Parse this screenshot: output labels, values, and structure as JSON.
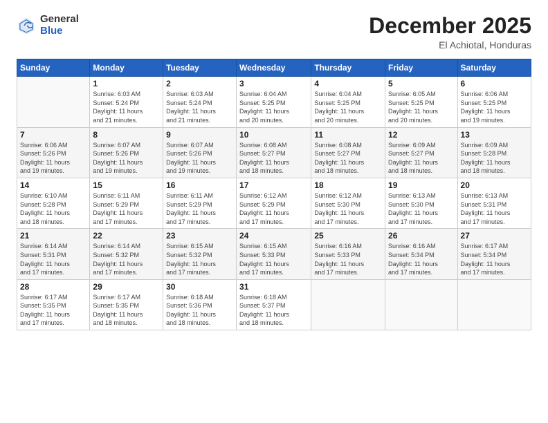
{
  "header": {
    "logo_general": "General",
    "logo_blue": "Blue",
    "month_title": "December 2025",
    "location": "El Achiotal, Honduras"
  },
  "days_of_week": [
    "Sunday",
    "Monday",
    "Tuesday",
    "Wednesday",
    "Thursday",
    "Friday",
    "Saturday"
  ],
  "weeks": [
    {
      "alt": false,
      "days": [
        {
          "num": "",
          "info": ""
        },
        {
          "num": "1",
          "info": "Sunrise: 6:03 AM\nSunset: 5:24 PM\nDaylight: 11 hours\nand 21 minutes."
        },
        {
          "num": "2",
          "info": "Sunrise: 6:03 AM\nSunset: 5:24 PM\nDaylight: 11 hours\nand 21 minutes."
        },
        {
          "num": "3",
          "info": "Sunrise: 6:04 AM\nSunset: 5:25 PM\nDaylight: 11 hours\nand 20 minutes."
        },
        {
          "num": "4",
          "info": "Sunrise: 6:04 AM\nSunset: 5:25 PM\nDaylight: 11 hours\nand 20 minutes."
        },
        {
          "num": "5",
          "info": "Sunrise: 6:05 AM\nSunset: 5:25 PM\nDaylight: 11 hours\nand 20 minutes."
        },
        {
          "num": "6",
          "info": "Sunrise: 6:06 AM\nSunset: 5:25 PM\nDaylight: 11 hours\nand 19 minutes."
        }
      ]
    },
    {
      "alt": true,
      "days": [
        {
          "num": "7",
          "info": "Sunrise: 6:06 AM\nSunset: 5:26 PM\nDaylight: 11 hours\nand 19 minutes."
        },
        {
          "num": "8",
          "info": "Sunrise: 6:07 AM\nSunset: 5:26 PM\nDaylight: 11 hours\nand 19 minutes."
        },
        {
          "num": "9",
          "info": "Sunrise: 6:07 AM\nSunset: 5:26 PM\nDaylight: 11 hours\nand 19 minutes."
        },
        {
          "num": "10",
          "info": "Sunrise: 6:08 AM\nSunset: 5:27 PM\nDaylight: 11 hours\nand 18 minutes."
        },
        {
          "num": "11",
          "info": "Sunrise: 6:08 AM\nSunset: 5:27 PM\nDaylight: 11 hours\nand 18 minutes."
        },
        {
          "num": "12",
          "info": "Sunrise: 6:09 AM\nSunset: 5:27 PM\nDaylight: 11 hours\nand 18 minutes."
        },
        {
          "num": "13",
          "info": "Sunrise: 6:09 AM\nSunset: 5:28 PM\nDaylight: 11 hours\nand 18 minutes."
        }
      ]
    },
    {
      "alt": false,
      "days": [
        {
          "num": "14",
          "info": "Sunrise: 6:10 AM\nSunset: 5:28 PM\nDaylight: 11 hours\nand 18 minutes."
        },
        {
          "num": "15",
          "info": "Sunrise: 6:11 AM\nSunset: 5:29 PM\nDaylight: 11 hours\nand 17 minutes."
        },
        {
          "num": "16",
          "info": "Sunrise: 6:11 AM\nSunset: 5:29 PM\nDaylight: 11 hours\nand 17 minutes."
        },
        {
          "num": "17",
          "info": "Sunrise: 6:12 AM\nSunset: 5:29 PM\nDaylight: 11 hours\nand 17 minutes."
        },
        {
          "num": "18",
          "info": "Sunrise: 6:12 AM\nSunset: 5:30 PM\nDaylight: 11 hours\nand 17 minutes."
        },
        {
          "num": "19",
          "info": "Sunrise: 6:13 AM\nSunset: 5:30 PM\nDaylight: 11 hours\nand 17 minutes."
        },
        {
          "num": "20",
          "info": "Sunrise: 6:13 AM\nSunset: 5:31 PM\nDaylight: 11 hours\nand 17 minutes."
        }
      ]
    },
    {
      "alt": true,
      "days": [
        {
          "num": "21",
          "info": "Sunrise: 6:14 AM\nSunset: 5:31 PM\nDaylight: 11 hours\nand 17 minutes."
        },
        {
          "num": "22",
          "info": "Sunrise: 6:14 AM\nSunset: 5:32 PM\nDaylight: 11 hours\nand 17 minutes."
        },
        {
          "num": "23",
          "info": "Sunrise: 6:15 AM\nSunset: 5:32 PM\nDaylight: 11 hours\nand 17 minutes."
        },
        {
          "num": "24",
          "info": "Sunrise: 6:15 AM\nSunset: 5:33 PM\nDaylight: 11 hours\nand 17 minutes."
        },
        {
          "num": "25",
          "info": "Sunrise: 6:16 AM\nSunset: 5:33 PM\nDaylight: 11 hours\nand 17 minutes."
        },
        {
          "num": "26",
          "info": "Sunrise: 6:16 AM\nSunset: 5:34 PM\nDaylight: 11 hours\nand 17 minutes."
        },
        {
          "num": "27",
          "info": "Sunrise: 6:17 AM\nSunset: 5:34 PM\nDaylight: 11 hours\nand 17 minutes."
        }
      ]
    },
    {
      "alt": false,
      "days": [
        {
          "num": "28",
          "info": "Sunrise: 6:17 AM\nSunset: 5:35 PM\nDaylight: 11 hours\nand 17 minutes."
        },
        {
          "num": "29",
          "info": "Sunrise: 6:17 AM\nSunset: 5:35 PM\nDaylight: 11 hours\nand 18 minutes."
        },
        {
          "num": "30",
          "info": "Sunrise: 6:18 AM\nSunset: 5:36 PM\nDaylight: 11 hours\nand 18 minutes."
        },
        {
          "num": "31",
          "info": "Sunrise: 6:18 AM\nSunset: 5:37 PM\nDaylight: 11 hours\nand 18 minutes."
        },
        {
          "num": "",
          "info": ""
        },
        {
          "num": "",
          "info": ""
        },
        {
          "num": "",
          "info": ""
        }
      ]
    }
  ]
}
